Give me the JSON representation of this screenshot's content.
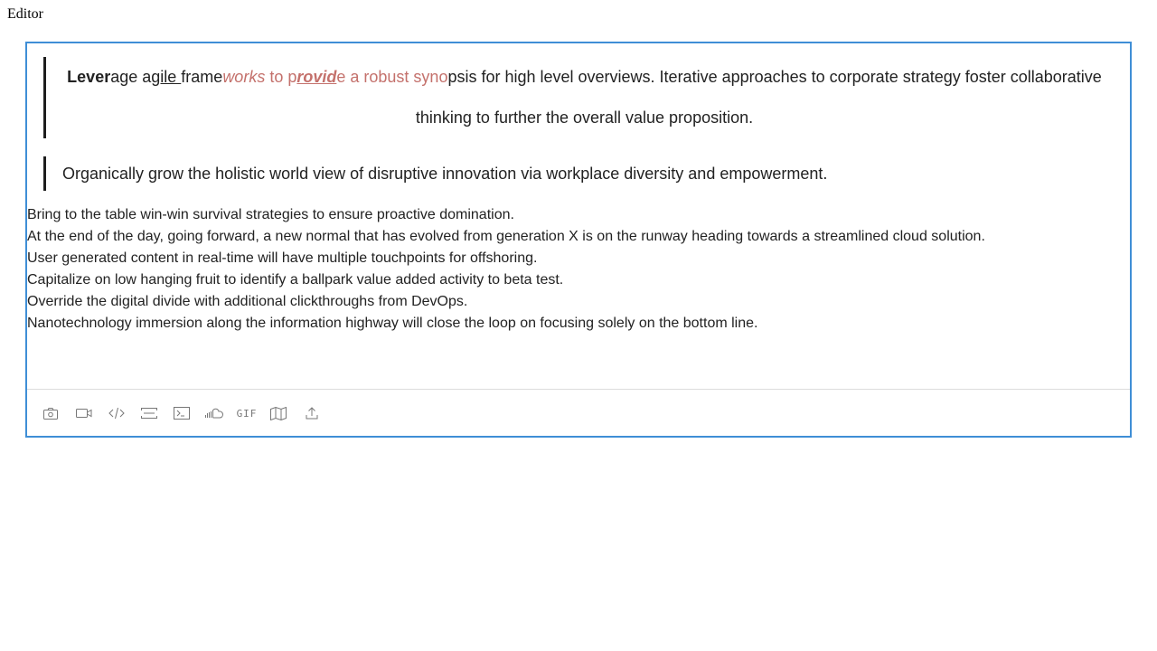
{
  "page": {
    "title": "Editor"
  },
  "quote1": {
    "seg1": "Lever",
    "seg2": "age a",
    "seg3": "gile ",
    "seg4": "frame",
    "seg5": "works",
    "seg6": " to p",
    "seg7": "rovid",
    "seg8": "e a robust syno",
    "seg9": "psis for high level overviews. Iterative approaches to corporate strategy foster collaborative thinking to further the overall value proposition."
  },
  "quote2": {
    "text": "Organically grow the holistic world view of disruptive innovation via workplace diversity and empowerment."
  },
  "paragraphs": [
    "Bring to the table win-win survival strategies to ensure proactive domination.",
    "At the end of the day, going forward, a new normal that has evolved from generation X is on the runway heading towards a streamlined cloud solution.",
    "User generated content in real-time will have multiple touchpoints for offshoring.",
    "Capitalize on low hanging fruit to identify a ballpark value added activity to beta test.",
    "Override the digital divide with additional clickthroughs from DevOps.",
    "Nanotechnology immersion along the information highway will close the loop on focusing solely on the bottom line."
  ],
  "toolbar": {
    "gif_label": "GIF",
    "icons": [
      "camera-icon",
      "video-icon",
      "code-icon",
      "divider-icon",
      "terminal-icon",
      "soundcloud-icon",
      "gif-icon",
      "map-icon",
      "upload-icon"
    ]
  },
  "colors": {
    "accent": "#3f8ed6",
    "highlight": "#c4716c",
    "quote_bar": "#1e1e1e"
  }
}
